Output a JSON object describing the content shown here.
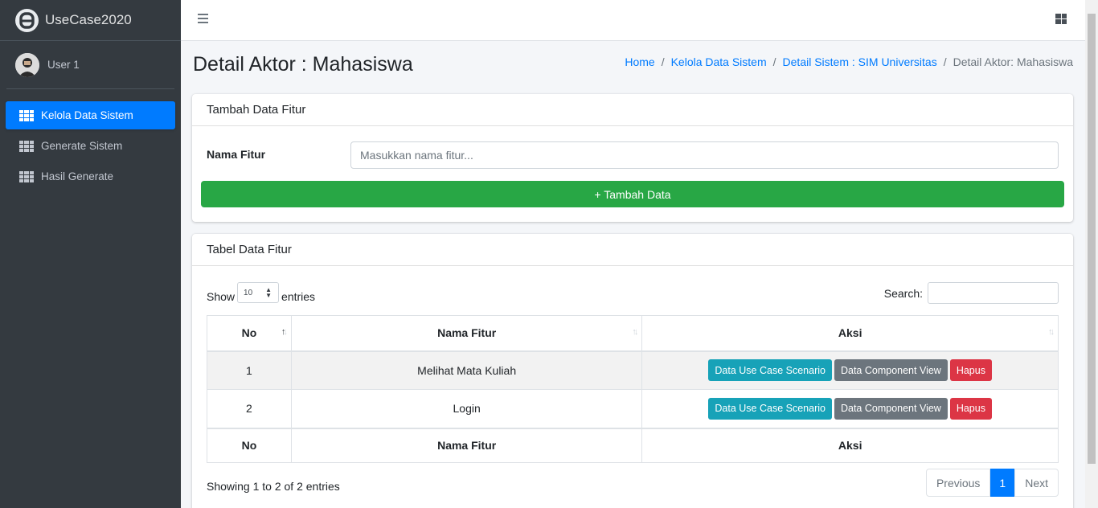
{
  "brand": {
    "name": "UseCase2020"
  },
  "user": {
    "name": "User 1"
  },
  "sidebar": {
    "items": [
      {
        "label": "Kelola Data Sistem",
        "active": true
      },
      {
        "label": "Generate Sistem",
        "active": false
      },
      {
        "label": "Hasil Generate",
        "active": false
      }
    ]
  },
  "page": {
    "title": "Detail Aktor : Mahasiswa"
  },
  "breadcrumb": {
    "items": [
      "Home",
      "Kelola Data Sistem",
      "Detail Sistem : SIM Universitas"
    ],
    "current": "Detail Aktor: Mahasiswa",
    "separator": "/"
  },
  "form_card": {
    "title": "Tambah Data Fitur",
    "label": "Nama Fitur",
    "input_value": "",
    "input_placeholder": "Masukkan nama fitur...",
    "submit_label": "+ Tambah Data"
  },
  "table_card": {
    "title": "Tabel Data Fitur",
    "show_label": "Show",
    "entries_value": "10",
    "entries_label": "entries",
    "search_label": "Search:",
    "columns": [
      "No",
      "Nama Fitur",
      "Aksi"
    ],
    "rows": [
      {
        "no": "1",
        "name": "Melihat Mata Kuliah"
      },
      {
        "no": "2",
        "name": "Login"
      }
    ],
    "action_labels": {
      "scenario": "Data Use Case Scenario",
      "component": "Data Component View",
      "delete": "Hapus"
    },
    "info": "Showing 1 to 2 of 2 entries",
    "pagination": {
      "previous": "Previous",
      "current": "1",
      "next": "Next"
    }
  },
  "colors": {
    "sidebar_bg": "#343a40",
    "primary": "#007bff",
    "success": "#28a745",
    "info": "#17a2b8",
    "secondary": "#6c757d",
    "danger": "#dc3545"
  }
}
